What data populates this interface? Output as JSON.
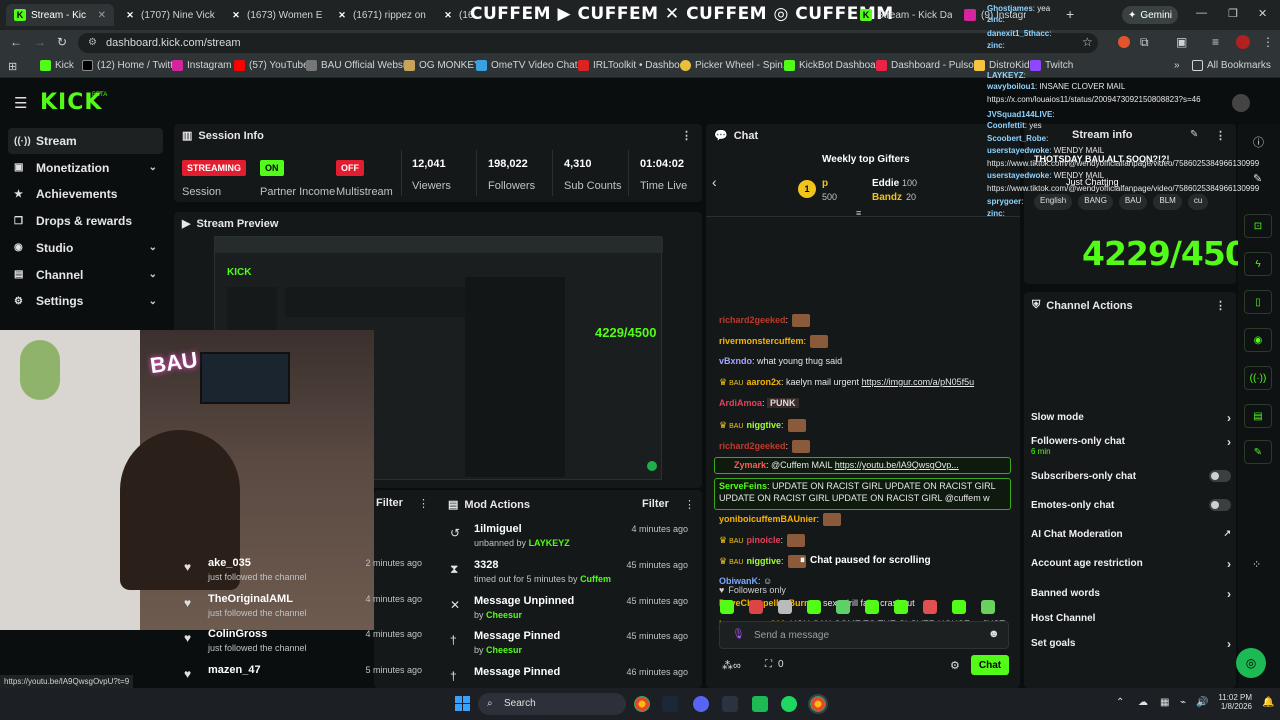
{
  "tabs": [
    {
      "label": "Stream - Kic",
      "active": true
    },
    {
      "label": "(1707) Nine Vick"
    },
    {
      "label": "(1673) Women E"
    },
    {
      "label": "(1671) rippez on"
    },
    {
      "label": "(16"
    },
    {
      "label": "Stream - Kick Da"
    },
    {
      "label": "(9) Instagram"
    }
  ],
  "overlay_banner": "CUFFEM ▶ CUFFEM ✕ CUFFEM ◎ CUFFEMM",
  "profile_label": "Gemini",
  "url": "dashboard.kick.com/stream",
  "bookmarks": [
    "Kick",
    "(12) Home / Twitter",
    "Instagram",
    "(57) YouTube",
    "BAU Official Website",
    "OG MONKEY",
    "OmeTV Video Chat...",
    "IRLToolkit • Dashbo...",
    "Picker Wheel - Spin...",
    "KickBot Dashboard",
    "Dashboard - Pulsoid",
    "DistroKid",
    "Twitch",
    "All Bookmarks"
  ],
  "logo": "KICK",
  "logo_beta": "BETA",
  "sidebar": [
    {
      "label": "Stream",
      "icon": "broadcast-icon",
      "glyph": "((·))",
      "active": true
    },
    {
      "label": "Monetization",
      "icon": "money-icon",
      "glyph": "▣",
      "chevron": true
    },
    {
      "label": "Achievements",
      "icon": "trophy-icon",
      "glyph": "★"
    },
    {
      "label": "Drops & rewards",
      "icon": "gift-icon",
      "glyph": "❐"
    },
    {
      "label": "Studio",
      "icon": "studio-icon",
      "glyph": "◉",
      "chevron": true
    },
    {
      "label": "Channel",
      "icon": "channel-icon",
      "glyph": "▤",
      "chevron": true
    },
    {
      "label": "Settings",
      "icon": "gear-icon",
      "glyph": "⚙",
      "chevron": true
    }
  ],
  "session": {
    "title": "Session Info",
    "streaming": "STREAMING",
    "session_label": "Session",
    "on": "ON",
    "partner_label": "Partner Income",
    "off": "OFF",
    "multistream_label": "Multistream",
    "stats": [
      {
        "value": "12,041",
        "label": "Viewers"
      },
      {
        "value": "198,022",
        "label": "Followers"
      },
      {
        "value": "4,310",
        "label": "Sub Counts"
      },
      {
        "value": "01:04:02",
        "label": "Time Live"
      }
    ]
  },
  "preview": {
    "title": "Stream Preview",
    "goal_overlay": "4229/4500"
  },
  "activity": {
    "filter": "Filter",
    "rows": [
      {
        "name": "ake_035",
        "sub": "just followed the channel",
        "time": "2 minutes ago"
      },
      {
        "name": "TheOriginalAML",
        "sub": "just followed the channel",
        "time": "4 minutes ago"
      },
      {
        "name": "ColinGross",
        "sub": "just followed the channel",
        "time": "4 minutes ago"
      },
      {
        "name": "mazen_47",
        "sub": "",
        "time": "5 minutes ago"
      }
    ]
  },
  "mod_actions": {
    "title": "Mod Actions",
    "filter": "Filter",
    "rows": [
      {
        "name": "1ilmiguel",
        "sub_prefix": "unbanned by ",
        "sub_user": "LAYKEYZ",
        "time": "4 minutes ago",
        "icon": "↺"
      },
      {
        "name": "3328",
        "sub_prefix": "timed out for 5 minutes by ",
        "sub_user": "Cuffem",
        "time": "45 minutes ago",
        "icon": "⧗"
      },
      {
        "name": "Message Unpinned",
        "sub_prefix": "by ",
        "sub_user": "Cheesur",
        "time": "45 minutes ago",
        "icon": "✕"
      },
      {
        "name": "Message Pinned",
        "sub_prefix": "by ",
        "sub_user": "Cheesur",
        "time": "45 minutes ago",
        "icon": "†"
      },
      {
        "name": "Message Pinned",
        "sub_prefix": "",
        "sub_user": "",
        "time": "46 minutes ago",
        "icon": "†"
      }
    ]
  },
  "chat": {
    "title": "Chat",
    "gifters_title": "Weekly top Gifters",
    "gifters": [
      {
        "rank": "1",
        "name": "p",
        "amount": "500"
      },
      {
        "name": "Eddie",
        "amount": "100"
      },
      {
        "name": "Bandz",
        "amount": "20"
      }
    ],
    "messages": [
      {
        "user": "richard2geeked",
        "color": "#c0392b",
        "text": ":",
        "emote": true
      },
      {
        "user": "rivermonstercuffem",
        "color": "#f7b500",
        "text": ":",
        "emote": true
      },
      {
        "user": "vBxndo",
        "color": "#a5a5ff",
        "text": ": what young thug said"
      },
      {
        "user": "aaron2x",
        "color": "#f7b500",
        "text": ": kaelyn mail urgent ",
        "link": "https://imgur.com/a/pN05f5u",
        "badges": true
      },
      {
        "user": "ArdiAmoa",
        "color": "#e7405a",
        "text": ": ",
        "emote_text": "PUNK"
      },
      {
        "user": "niggtive",
        "color": "#9dff2f",
        "text": ":",
        "emote": true,
        "badges": true
      },
      {
        "user": "richard2geeked",
        "color": "#c0392b",
        "text": ":",
        "emote": true
      },
      {
        "user": "Zymark",
        "color": "#ff5a5a",
        "text": ": @Cuffem MAIL ",
        "link": "https://youtu.be/lA9QwsgOvp...",
        "highlight": true
      },
      {
        "user": "ServeFeins",
        "color": "#53fc18",
        "text": ": UPDATE ON RACIST GIRL UPDATE ON RACIST GIRL",
        "line2": "UPDATE ON RACIST GIRL UPDATE ON RACIST GIRL @cuffem w",
        "highlight": true
      },
      {
        "user": "yoniboicuffemBAUnier",
        "color": "#f7b500",
        "text": ":",
        "emote": true
      },
      {
        "user": "pinoicle",
        "color": "#e7405a",
        "text": ":",
        "emote": true,
        "badges": true
      },
      {
        "user": "niggtive",
        "color": "#9dff2f",
        "text": ":",
        "emote": true,
        "badges": true
      },
      {
        "user": "ObiwanK",
        "color": "#7aa8ff",
        "text": ": ☺"
      },
      {
        "user": "DaveChappellesBurner",
        "color": "#f7b500",
        "text": ": sexy drill fake crashout"
      },
      {
        "user": "jayymoneyy210",
        "color": "#f7b500",
        "text": ": YOU CAN COME TO THE CLOVER HOUSE.... JUST",
        "line2": "LEAVE YOUR BOT"
      }
    ],
    "paused": "Chat paused for scrolling",
    "followers_only": "Followers only",
    "placeholder": "Send a message",
    "points": "0",
    "send": "Chat"
  },
  "stream_info": {
    "title": "Stream info",
    "stream_title": "THOTSDAY BAU ALT SOON?!?!",
    "category": "Just Chatting",
    "tags": [
      "English",
      "BANG",
      "BAU",
      "BLM",
      "cu"
    ],
    "goal": "4229/4500"
  },
  "channel_actions": {
    "title": "Channel Actions",
    "items": [
      {
        "label": "Slow mode",
        "ctrl": "chevron"
      },
      {
        "label": "Followers-only chat",
        "sub": "6 min",
        "ctrl": "chevron"
      },
      {
        "label": "Subscribers-only chat",
        "ctrl": "toggle"
      },
      {
        "label": "Emotes-only chat",
        "ctrl": "toggle"
      },
      {
        "label": "AI Chat Moderation",
        "ctrl": "external"
      },
      {
        "label": "Account age restriction",
        "ctrl": "chevron"
      },
      {
        "label": "Banned words",
        "ctrl": "chevron"
      },
      {
        "label": "Host Channel",
        "ctrl": "none"
      },
      {
        "label": "Set goals",
        "ctrl": "chevron"
      }
    ]
  },
  "overlay_chat": [
    {
      "user": "Ghostjames",
      "text": ": yea"
    },
    {
      "user": "zinc",
      "text": ":"
    },
    {
      "user": "danexit1_5thacc",
      "text": ":"
    },
    {
      "user": "zinc",
      "text": ":"
    },
    {
      "user": "LAYKEYZ",
      "text": ":"
    },
    {
      "user": "wavyboilou1",
      "text": ": INSANE CLOVER MAIL"
    },
    {
      "user": "",
      "text": "https://x.com/louaios11/status/2009473092150808823?s=46"
    },
    {
      "user": "JVSquad144LIVE",
      "text": ":"
    },
    {
      "user": "Coonfettit",
      "text": ": yes"
    },
    {
      "user": "Scoobert_Robe",
      "text": ":"
    },
    {
      "user": "userstayedwoke",
      "text": ": WENDY MAIL"
    },
    {
      "user": "",
      "text": "https://www.tiktok.com/@wendyofficialfanpage/video/7586025384966130999"
    },
    {
      "user": "userstayedwoke",
      "text": ": WENDY MAIL"
    },
    {
      "user": "",
      "text": "https://www.tiktok.com/@wendyofficialfanpage/video/7586025384966130999"
    },
    {
      "user": "sprygoer",
      "text": ":"
    },
    {
      "user": "zinc",
      "text": ":"
    }
  ],
  "status_url": "https://youtu.be/lA9QwsgOvpU?t=9",
  "taskbar": {
    "search": "Search",
    "time": "11:02 PM",
    "date": "1/8/2026"
  }
}
